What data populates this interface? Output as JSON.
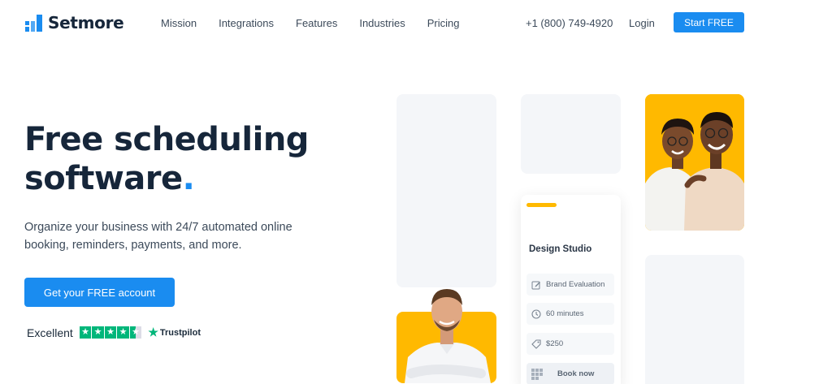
{
  "header": {
    "logo_text": "Setmore",
    "nav": [
      "Mission",
      "Integrations",
      "Features",
      "Industries",
      "Pricing"
    ],
    "phone": "+1 (800) 749-4920",
    "login": "Login",
    "start_label": "Start FREE"
  },
  "hero": {
    "title_line1": "Free scheduling",
    "title_line2": "software",
    "title_dot": ".",
    "subtitle": "Organize your business with 24/7 automated online booking, reminders, payments, and more.",
    "cta_label": "Get your FREE account",
    "rating_label": "Excellent",
    "rating_stars": 4.5,
    "trustpilot": "Trustpilot"
  },
  "booking_card": {
    "title": "Design Studio",
    "service": "Brand Evaluation",
    "duration": "60 minutes",
    "price": "$250",
    "book_label": "Book now"
  },
  "colors": {
    "accent": "#1a8cf0",
    "brand_dark": "#16263a",
    "highlight": "#ffb900",
    "trustpilot_green": "#00b67a"
  }
}
